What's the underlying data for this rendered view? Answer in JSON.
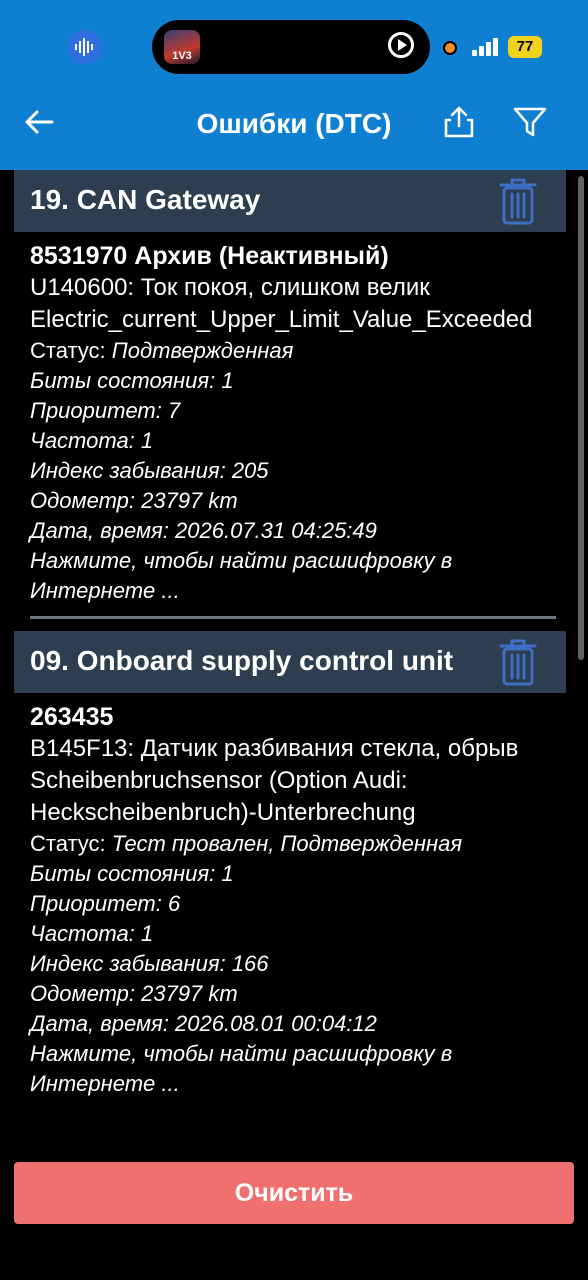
{
  "status_bar": {
    "battery": "77"
  },
  "island": {
    "app_label": "1V3"
  },
  "header": {
    "title": "Ошибки (DTC)"
  },
  "sections": [
    {
      "title": "19. CAN Gateway",
      "entry": {
        "code": "8531970 Архив (Неактивный)",
        "desc_lines": [
          "U140600: Ток покоя, слишком велик",
          "Electric_current_Upper_Limit_Value_Exceeded"
        ],
        "status_label": "Статус: ",
        "status_value": "Подтвержденная",
        "bits": "Биты состояния: 1",
        "priority": "Приоритет: 7",
        "frequency": "Частота: 1",
        "forget_index": "Индекс забывания: 205",
        "odometer": "Одометр: 23797 km",
        "datetime": "Дата, время: 2026.07.31 04:25:49",
        "lookup": "Нажмите, чтобы найти расшифровку в Интернете ..."
      }
    },
    {
      "title": "09. Onboard supply control unit",
      "entry": {
        "code": "263435",
        "desc_lines": [
          "B145F13: Датчик разбивания стекла, обрыв",
          "Scheibenbruchsensor (Option Audi: Heckscheibenbruch)-Unterbrechung"
        ],
        "status_label": "Статус: ",
        "status_value": "Тест провален, Подтвержденная",
        "bits": "Биты состояния: 1",
        "priority": "Приоритет: 6",
        "frequency": "Частота: 1",
        "forget_index": "Индекс забывания: 166",
        "odometer": "Одометр: 23797 km",
        "datetime": "Дата, время: 2026.08.01 00:04:12",
        "lookup": "Нажмите, чтобы найти расшифровку в Интернете ..."
      }
    }
  ],
  "footer": {
    "clear_label": "Очистить"
  },
  "colors": {
    "app_bar": "#0f7fd1",
    "section_header": "#2d3e50",
    "trash": "#3f6fc4",
    "clear_button": "#f07070"
  }
}
